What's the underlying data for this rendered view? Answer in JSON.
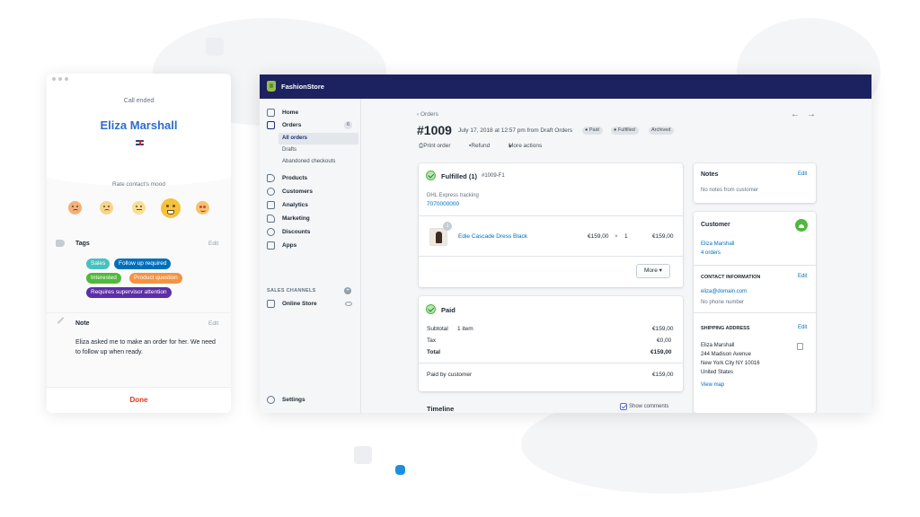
{
  "call_panel": {
    "status": "Call ended",
    "contact_name": "Eliza Marshall",
    "rate_label": "Rate contact's mood",
    "tags_label": "Tags",
    "tags_edit": "Edit",
    "tags": [
      {
        "label": "Sales",
        "color": "#47c1bf"
      },
      {
        "label": "Follow up required",
        "color": "#006fbb"
      },
      {
        "label": "Interested",
        "color": "#50b83c"
      },
      {
        "label": "Product question",
        "color": "#f49342"
      },
      {
        "label": "Requires supervisor attention",
        "color": "#5c2fa8"
      }
    ],
    "note_label": "Note",
    "note_edit": "Edit",
    "note_text": "Eliza asked me to make an order for her. We need to follow up when ready.",
    "done_label": "Done"
  },
  "store": {
    "name": "FashionStore",
    "nav": [
      {
        "label": "Home",
        "icon": "home-icon"
      },
      {
        "label": "Orders",
        "icon": "orders-icon",
        "badge": "6"
      },
      {
        "label": "Products",
        "icon": "tag-icon"
      },
      {
        "label": "Customers",
        "icon": "customers-icon"
      },
      {
        "label": "Analytics",
        "icon": "analytics-icon"
      },
      {
        "label": "Marketing",
        "icon": "marketing-icon"
      },
      {
        "label": "Discounts",
        "icon": "discounts-icon"
      },
      {
        "label": "Apps",
        "icon": "apps-icon"
      }
    ],
    "orders_sub": [
      "All orders",
      "Drafts",
      "Abandoned checkouts"
    ],
    "sales_channels_label": "SALES CHANNELS",
    "online_store": "Online Store",
    "settings": "Settings"
  },
  "order": {
    "breadcrumb": "Orders",
    "number": "#1009",
    "meta": "July 17, 2018 at 12:57 pm from Draft Orders",
    "badges": [
      "Paid",
      "Fulfilled",
      "Archived"
    ],
    "actions": [
      "Print order",
      "Refund",
      "More actions"
    ],
    "fulfilled": {
      "title": "Fulfilled (1)",
      "id": "#1009-F1",
      "tracking_label": "DHL Express tracking",
      "tracking_number": "7070000000",
      "item_name": "Edie Cascade Dress Black",
      "item_qty_badge": "1",
      "unit_price": "€159,00",
      "times": "×",
      "qty": "1",
      "line_total": "€159,00",
      "more_button": "More"
    },
    "paid": {
      "title": "Paid",
      "subtotal_label": "Subtotal",
      "subtotal_items": "1 item",
      "subtotal": "€159,00",
      "tax_label": "Tax",
      "tax": "€0,00",
      "total_label": "Total",
      "total": "€159,00",
      "paid_by_label": "Paid by customer",
      "paid_by": "€159,00"
    },
    "timeline": {
      "title": "Timeline",
      "show_comments": "Show comments"
    }
  },
  "right": {
    "notes_title": "Notes",
    "notes_edit": "Edit",
    "notes_empty": "No notes from customer",
    "customer_title": "Customer",
    "customer_name": "Eliza Marshall",
    "customer_orders": "4 orders",
    "contact_title": "CONTACT INFORMATION",
    "contact_edit": "Edit",
    "email": "eliza@domain.com",
    "phone": "No phone number",
    "shipping_title": "SHIPPING ADDRESS",
    "shipping_edit": "Edit",
    "address": [
      "Eliza Marshall",
      "244 Madison Avenue",
      "New York City NY 10016",
      "United States"
    ],
    "view_map": "View map"
  }
}
